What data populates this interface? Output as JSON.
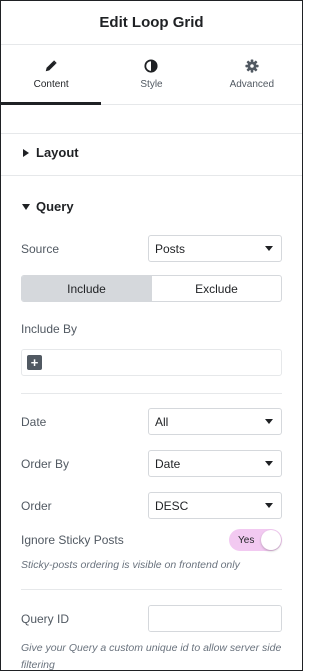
{
  "header": {
    "title": "Edit Loop Grid"
  },
  "tabs": [
    {
      "label": "Content",
      "icon": "pencil-icon",
      "active": true
    },
    {
      "label": "Style",
      "icon": "half-circle-icon",
      "active": false
    },
    {
      "label": "Advanced",
      "icon": "gear-icon",
      "active": false
    }
  ],
  "sections": {
    "layout": {
      "label": "Layout",
      "expanded": false
    },
    "query": {
      "label": "Query",
      "expanded": true
    }
  },
  "query": {
    "source": {
      "label": "Source",
      "value": "Posts"
    },
    "include_tabs": {
      "include": "Include",
      "exclude": "Exclude",
      "selected": "Include"
    },
    "include_by": {
      "label": "Include By",
      "add_icon": "+"
    },
    "date": {
      "label": "Date",
      "value": "All"
    },
    "order_by": {
      "label": "Order By",
      "value": "Date"
    },
    "order": {
      "label": "Order",
      "value": "DESC"
    },
    "ignore_sticky": {
      "label": "Ignore Sticky Posts",
      "state": "Yes"
    },
    "sticky_note": "Sticky-posts ordering is visible on frontend only",
    "query_id": {
      "label": "Query ID",
      "value": "",
      "placeholder": ""
    },
    "query_id_note": "Give your Query a custom unique id to allow server side filtering"
  },
  "colors": {
    "text": "#1f2124",
    "muted": "#515962",
    "border": "#d5d8dc",
    "switch_on": "#f2c9f1",
    "segment_selected": "#d5d8dc"
  }
}
